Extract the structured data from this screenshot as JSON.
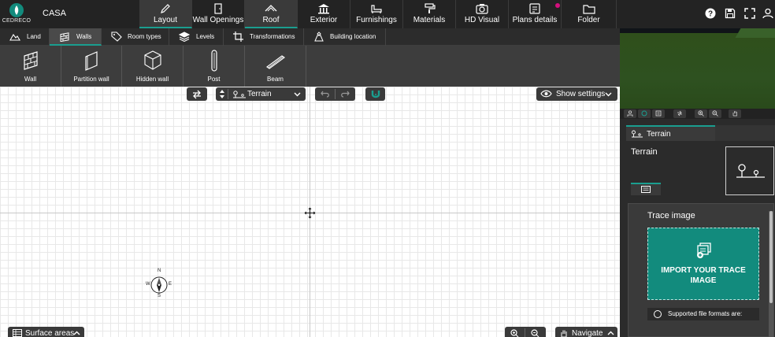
{
  "app": {
    "logo_text": "CEDRECO",
    "project_name": "CASA"
  },
  "main_tabs": [
    {
      "label": "Layout",
      "icon": "pencil-icon",
      "active": true
    },
    {
      "label": "Wall Openings",
      "icon": "door-icon",
      "active": false
    },
    {
      "label": "Roof",
      "icon": "roof-icon",
      "active": true
    },
    {
      "label": "Exterior",
      "icon": "house-columns-icon",
      "active": false
    },
    {
      "label": "Furnishings",
      "icon": "sofa-icon",
      "active": false
    },
    {
      "label": "Materials",
      "icon": "paint-roller-icon",
      "active": false
    },
    {
      "label": "HD Visual",
      "icon": "camera-icon",
      "active": false
    },
    {
      "label": "Plans details",
      "icon": "plans-icon",
      "active": false
    },
    {
      "label": "Folder",
      "icon": "folder-icon",
      "active": false
    }
  ],
  "top_right_icons": [
    "help-icon",
    "save-icon",
    "fullscreen-icon",
    "user-icon"
  ],
  "sub_tabs": [
    {
      "label": "Land",
      "icon": "mountain-icon",
      "active": false
    },
    {
      "label": "Walls",
      "icon": "wall-brick-icon",
      "active": true
    },
    {
      "label": "Room types",
      "icon": "tag-icon",
      "active": false
    },
    {
      "label": "Levels",
      "icon": "layers-icon",
      "active": false
    },
    {
      "label": "Transformations",
      "icon": "crop-icon",
      "active": false
    },
    {
      "label": "Building location",
      "icon": "building-location-icon",
      "active": false
    }
  ],
  "tools": [
    {
      "label": "Wall",
      "icon": "brick-wall-icon"
    },
    {
      "label": "Partition wall",
      "icon": "partition-icon"
    },
    {
      "label": "Hidden wall",
      "icon": "cube-icon"
    },
    {
      "label": "Post",
      "icon": "post-icon"
    },
    {
      "label": "Beam",
      "icon": "beam-icon"
    }
  ],
  "canvas_controls": {
    "level_select": "Terrain",
    "show_settings": "Show settings",
    "surface_areas": "Surface areas",
    "navigate": "Navigate"
  },
  "compass": {
    "n": "N",
    "s": "S",
    "e": "E",
    "w": "W"
  },
  "right_panel": {
    "tab_label": "Terrain",
    "title": "Terrain",
    "trace_heading": "Trace image",
    "import_label": "IMPORT YOUR TRACE IMAGE",
    "supported_formats": "Supported file formats are:"
  },
  "colors": {
    "accent": "#1a9e8f",
    "import_button": "#128b7d",
    "notification": "#d40f7d",
    "topbar": "#232323"
  }
}
